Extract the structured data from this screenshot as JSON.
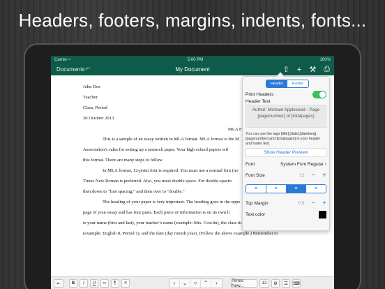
{
  "headline": "Headers, footers, margins, indents, fonts...",
  "status": {
    "carrier": "Carrier ≈",
    "time": "5:00 PM",
    "battery": "100%"
  },
  "nav": {
    "back_label": "Documents",
    "title": "My Document",
    "icons": [
      "share-arrow-icon",
      "add-icon",
      "wrench-icon",
      "export-icon"
    ]
  },
  "document": {
    "lines": [
      "John Doe",
      "Teacher",
      "Class, Period",
      "30 October 2013",
      "MLA Formatting Guide",
      "This is a sample of an essay written in MLA format.  MLA format is the M",
      "Association’s rules for setting up a research paper.  Your high school papers wil",
      "this format.  There are many steps to follow.",
      "In MLA format, 12-point font is required.  You must use a normal font (no",
      "Times New Roman is preferred. Also, you must double space. For double-spacin",
      "then down to \"line spacing,\" and then over to \"double.\"",
      "The heading of your paper is very important.  The heading goes in the uppe",
      "page of your essay and has four parts.  Each piece of information is on its own li",
      "is your name (first and last), your teacher’s name (example: Mrs. Cowlin), the class title and period",
      "(example: English 8, Period 1), and the date (day month year). (Follow the above example.) Remember to"
    ]
  },
  "popover": {
    "tabs": [
      "Header",
      "Footer"
    ],
    "active_tab": "Header",
    "print_headers_label": "Print Headers",
    "print_headers_on": true,
    "header_text_label": "Header Text",
    "header_text_value": "Author: Michael Appleseed - Page [pagenumber] of [totalpages]",
    "help_text": "You can use the tags [title],[date],[datelong], [pagenumber] and [totalpages] in your header and footer text.",
    "preview_button": "Show Header Preview",
    "font_label": "Font",
    "font_value": "System Font Regular",
    "font_size_label": "Font Size",
    "font_size_value": "12",
    "alignment_options": [
      "left",
      "center",
      "right",
      "justify"
    ],
    "alignment_selected": "right",
    "top_margin_label": "Top Margin",
    "top_margin_value": "0.5",
    "text_color_label": "Text color",
    "text_color": "#000000"
  },
  "toolbar": {
    "bold": "B",
    "italic": "I",
    "underline": "U",
    "link": "∞",
    "paragraph": "¶",
    "font_name": "Times New...",
    "font_size": "12"
  },
  "colors": {
    "accent": "#0e5b4a",
    "blue": "#2a7bd6",
    "toggle": "#3dbf5a"
  }
}
